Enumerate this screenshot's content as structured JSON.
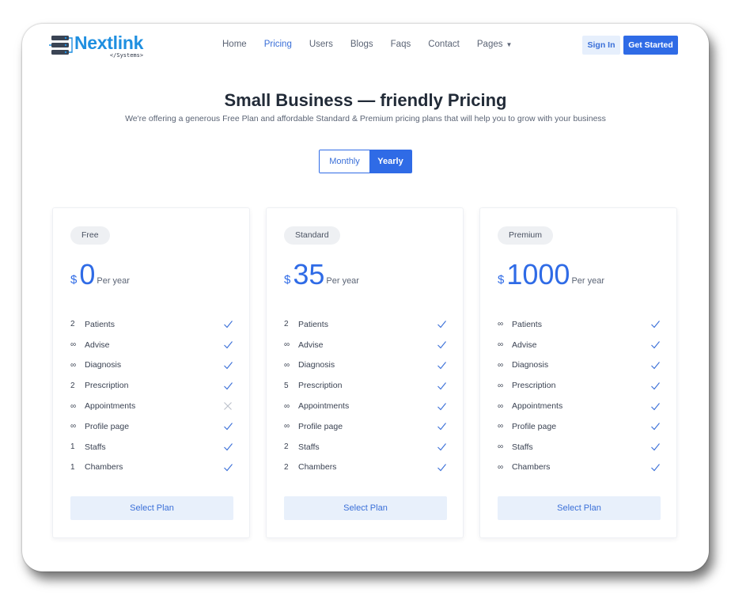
{
  "brand": {
    "name": "Nextlink",
    "tagline": "</Systems>"
  },
  "nav": {
    "items": [
      "Home",
      "Pricing",
      "Users",
      "Blogs",
      "Faqs",
      "Contact",
      "Pages"
    ],
    "active": "Pricing",
    "sign_in": "Sign In",
    "get_started": "Get Started"
  },
  "hero": {
    "title": "Small Business — friendly Pricing",
    "subtitle": "We're offering a generous Free Plan and affordable Standard & Premium pricing plans that will help you to grow with your business"
  },
  "billing_toggle": {
    "monthly": "Monthly",
    "yearly": "Yearly",
    "selected": "Yearly"
  },
  "colors": {
    "accent": "#2f6be6",
    "check": "#3a6fd8",
    "cross": "#b8bec8"
  },
  "plans": [
    {
      "name": "Free",
      "currency": "$",
      "price": "0",
      "period": "Per year",
      "button": "Select Plan",
      "features": [
        {
          "qty": "2",
          "label": "Patients",
          "included": true
        },
        {
          "qty": "∞",
          "label": "Advise",
          "included": true
        },
        {
          "qty": "∞",
          "label": "Diagnosis",
          "included": true
        },
        {
          "qty": "2",
          "label": "Prescription",
          "included": true
        },
        {
          "qty": "∞",
          "label": "Appointments",
          "included": false
        },
        {
          "qty": "∞",
          "label": "Profile page",
          "included": true
        },
        {
          "qty": "1",
          "label": "Staffs",
          "included": true
        },
        {
          "qty": "1",
          "label": "Chambers",
          "included": true
        }
      ]
    },
    {
      "name": "Standard",
      "currency": "$",
      "price": "35",
      "period": "Per year",
      "button": "Select Plan",
      "features": [
        {
          "qty": "2",
          "label": "Patients",
          "included": true
        },
        {
          "qty": "∞",
          "label": "Advise",
          "included": true
        },
        {
          "qty": "∞",
          "label": "Diagnosis",
          "included": true
        },
        {
          "qty": "5",
          "label": "Prescription",
          "included": true
        },
        {
          "qty": "∞",
          "label": "Appointments",
          "included": true
        },
        {
          "qty": "∞",
          "label": "Profile page",
          "included": true
        },
        {
          "qty": "2",
          "label": "Staffs",
          "included": true
        },
        {
          "qty": "2",
          "label": "Chambers",
          "included": true
        }
      ]
    },
    {
      "name": "Premium",
      "currency": "$",
      "price": "1000",
      "period": "Per year",
      "button": "Select Plan",
      "features": [
        {
          "qty": "∞",
          "label": "Patients",
          "included": true
        },
        {
          "qty": "∞",
          "label": "Advise",
          "included": true
        },
        {
          "qty": "∞",
          "label": "Diagnosis",
          "included": true
        },
        {
          "qty": "∞",
          "label": "Prescription",
          "included": true
        },
        {
          "qty": "∞",
          "label": "Appointments",
          "included": true
        },
        {
          "qty": "∞",
          "label": "Profile page",
          "included": true
        },
        {
          "qty": "∞",
          "label": "Staffs",
          "included": true
        },
        {
          "qty": "∞",
          "label": "Chambers",
          "included": true
        }
      ]
    }
  ]
}
